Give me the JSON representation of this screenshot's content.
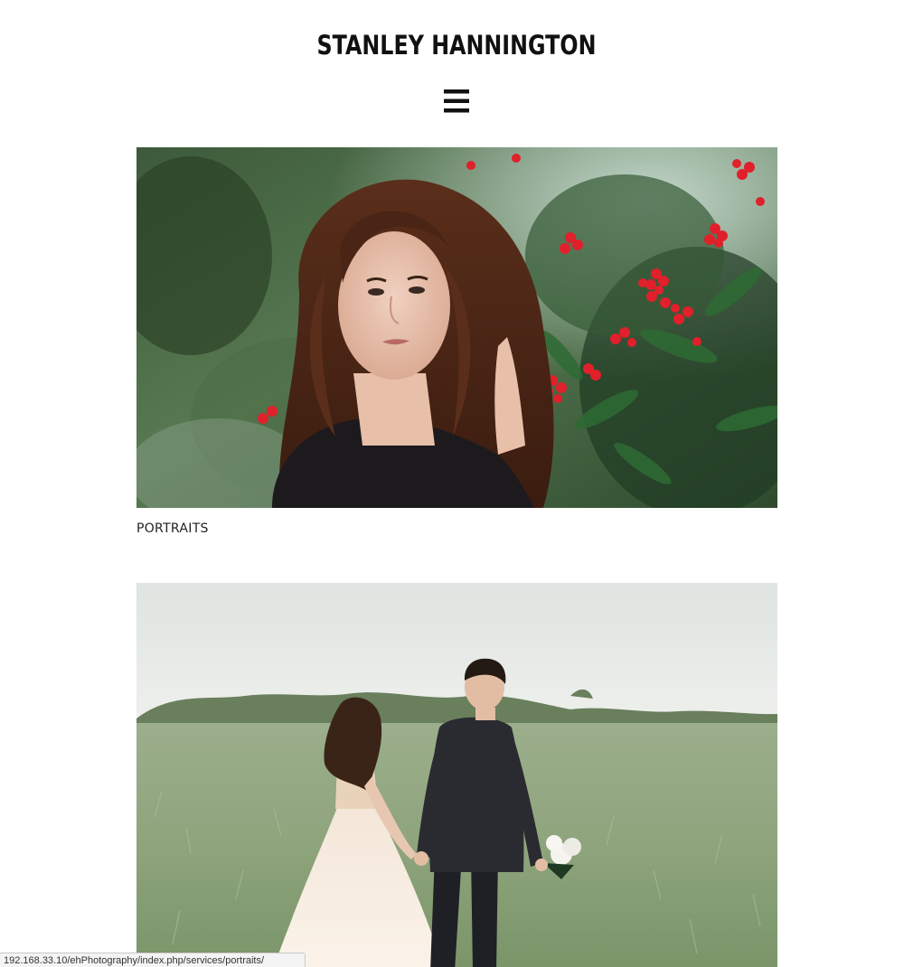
{
  "site": {
    "title": "STANLEY HANNINGTON"
  },
  "nav": {
    "menu_icon": "hamburger-menu-icon"
  },
  "gallery": {
    "items": [
      {
        "caption": "PORTRAITS",
        "image_subject": "woman-with-curly-hair-beside-red-berry-tree"
      },
      {
        "image_subject": "bride-and-groom-walking-in-grass-field"
      }
    ]
  },
  "status_bar": {
    "url": "192.168.33.10/ehPhotography/index.php/services/portraits/"
  },
  "colors": {
    "text": "#111111",
    "background": "#ffffff"
  }
}
